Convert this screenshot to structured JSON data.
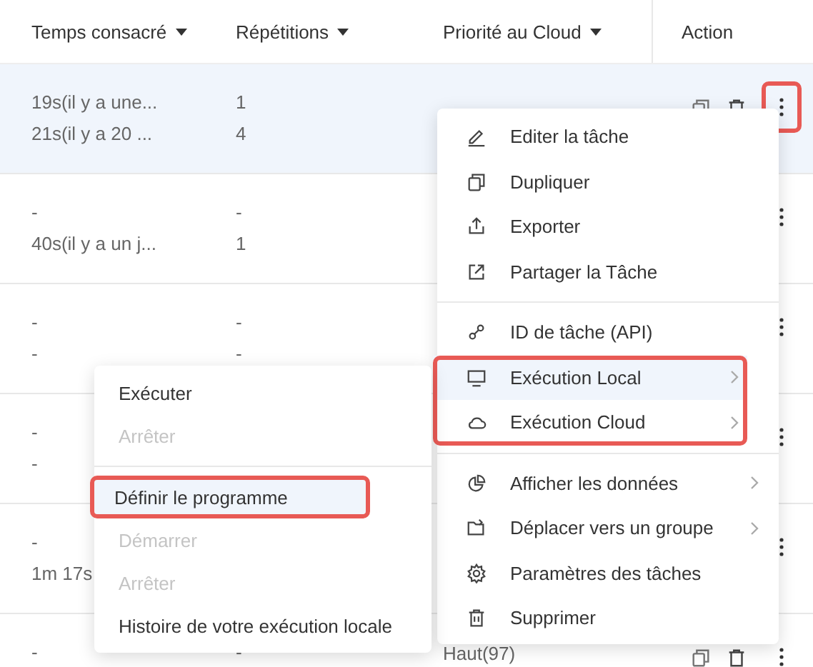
{
  "table": {
    "columns": [
      "Temps consacré",
      "Répétitions",
      "Priorité au Cloud",
      "Action"
    ],
    "rows": [
      {
        "selected": true,
        "cells": [
          [
            "19s(il y a une...",
            "21s(il y a 20 ..."
          ],
          [
            "1",
            "4"
          ],
          []
        ],
        "more_highlighted": true
      },
      {
        "selected": false,
        "cells": [
          [
            "-",
            "40s(il y a un j..."
          ],
          [
            "-",
            "1"
          ],
          []
        ],
        "more_highlighted": false
      },
      {
        "selected": false,
        "cells": [
          [
            "-",
            "-"
          ],
          [
            "-",
            "-"
          ],
          []
        ],
        "more_highlighted": false
      },
      {
        "selected": false,
        "cells": [
          [
            "-",
            "-"
          ],
          [],
          []
        ],
        "more_highlighted": false
      },
      {
        "selected": false,
        "cells": [
          [
            "-",
            "1m 17s"
          ],
          [],
          []
        ],
        "more_highlighted": false
      },
      {
        "selected": false,
        "cells": [
          [
            "-"
          ],
          [
            "-"
          ],
          [
            "Haut(97)"
          ]
        ],
        "more_highlighted": false
      }
    ]
  },
  "context_menu": {
    "sections": [
      {
        "divider": false,
        "highlighted": false,
        "items": [
          {
            "label": "Editer la tâche",
            "submenu": false,
            "selected": false
          },
          {
            "label": "Dupliquer",
            "submenu": false,
            "selected": false
          },
          {
            "label": "Exporter",
            "submenu": false,
            "selected": false
          },
          {
            "label": "Partager la Tâche",
            "submenu": false,
            "selected": false
          }
        ]
      },
      {
        "divider": true,
        "highlighted": false,
        "items": [
          {
            "label": "ID de tâche (API)",
            "submenu": false,
            "selected": false
          }
        ]
      },
      {
        "divider": false,
        "highlighted": true,
        "items": [
          {
            "label": "Exécution Local",
            "submenu": true,
            "selected": true
          },
          {
            "label": "Exécution Cloud",
            "submenu": true,
            "selected": false
          }
        ]
      },
      {
        "divider": true,
        "highlighted": false,
        "items": [
          {
            "label": "Afficher les données",
            "submenu": true,
            "selected": false
          },
          {
            "label": "Déplacer vers un groupe",
            "submenu": true,
            "selected": false
          },
          {
            "label": "Paramètres des tâches",
            "submenu": false,
            "selected": false
          },
          {
            "label": "Supprimer",
            "submenu": false,
            "selected": false
          }
        ]
      }
    ]
  },
  "submenu": {
    "sections": [
      {
        "items": [
          {
            "label": "Exécuter",
            "disabled": false,
            "selected": false,
            "highlighted": false
          },
          {
            "label": "Arrêter",
            "disabled": true,
            "selected": false,
            "highlighted": false
          }
        ]
      },
      {
        "items": [
          {
            "label": "Définir le programme",
            "disabled": false,
            "selected": true,
            "highlighted": true
          },
          {
            "label": "Démarrer",
            "disabled": true,
            "selected": false,
            "highlighted": false
          },
          {
            "label": "Arrêter",
            "disabled": true,
            "selected": false,
            "highlighted": false
          },
          {
            "label": "Histoire de votre exécution locale",
            "disabled": false,
            "selected": false,
            "highlighted": false
          }
        ]
      }
    ]
  }
}
